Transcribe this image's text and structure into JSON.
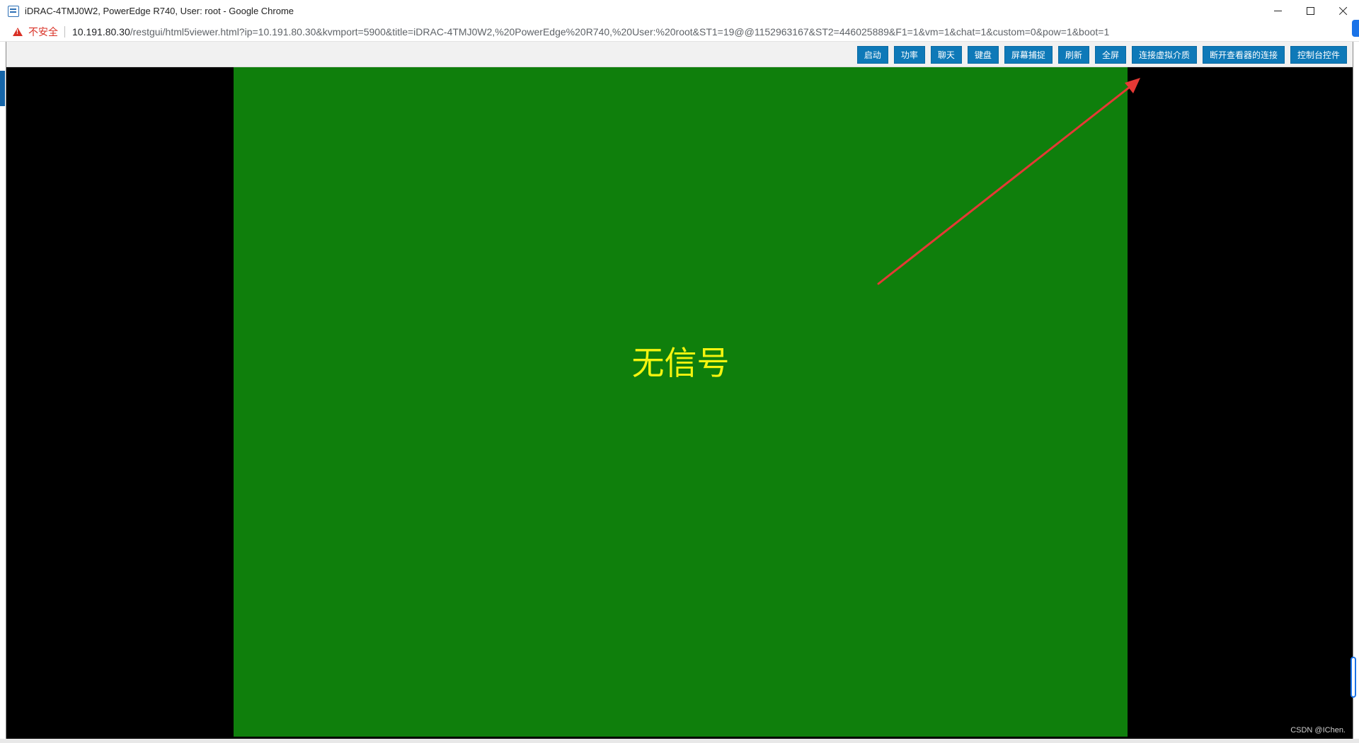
{
  "window": {
    "title": "iDRAC-4TMJ0W2, PowerEdge R740, User: root - Google Chrome",
    "controls": {
      "minimize": "minimize-icon",
      "maximize": "maximize-icon",
      "close": "close-icon"
    }
  },
  "address": {
    "security_icon": "warning-icon",
    "security_label": "不安全",
    "host": "10.191.80.30",
    "path": "/restgui/html5viewer.html?ip=10.191.80.30&kvmport=5900&title=iDRAC-4TMJ0W2,%20PowerEdge%20R740,%20User:%20root&ST1=19@@1152963167&ST2=446025889&F1=1&vm=1&chat=1&custom=0&pow=1&boot=1"
  },
  "toolbar": {
    "buttons": [
      {
        "id": "boot",
        "label": "启动"
      },
      {
        "id": "power",
        "label": "功率"
      },
      {
        "id": "chat",
        "label": "聊天"
      },
      {
        "id": "keyboard",
        "label": "键盘"
      },
      {
        "id": "screen-capture",
        "label": "屏幕捕捉"
      },
      {
        "id": "refresh",
        "label": "刷新"
      },
      {
        "id": "fullscreen",
        "label": "全屏"
      },
      {
        "id": "connect-virtual-media",
        "label": "连接虚拟介质"
      },
      {
        "id": "disconnect-viewer",
        "label": "断开查看器的连接"
      },
      {
        "id": "console-controls",
        "label": "控制台控件"
      }
    ],
    "button_color": "#0e79b8"
  },
  "screen": {
    "message": "无信号",
    "background_color": "#0f7f0c",
    "message_color": "#f4f40f"
  },
  "annotation": {
    "arrow_color": "#e53935"
  },
  "watermark": "CSDN @IChen."
}
